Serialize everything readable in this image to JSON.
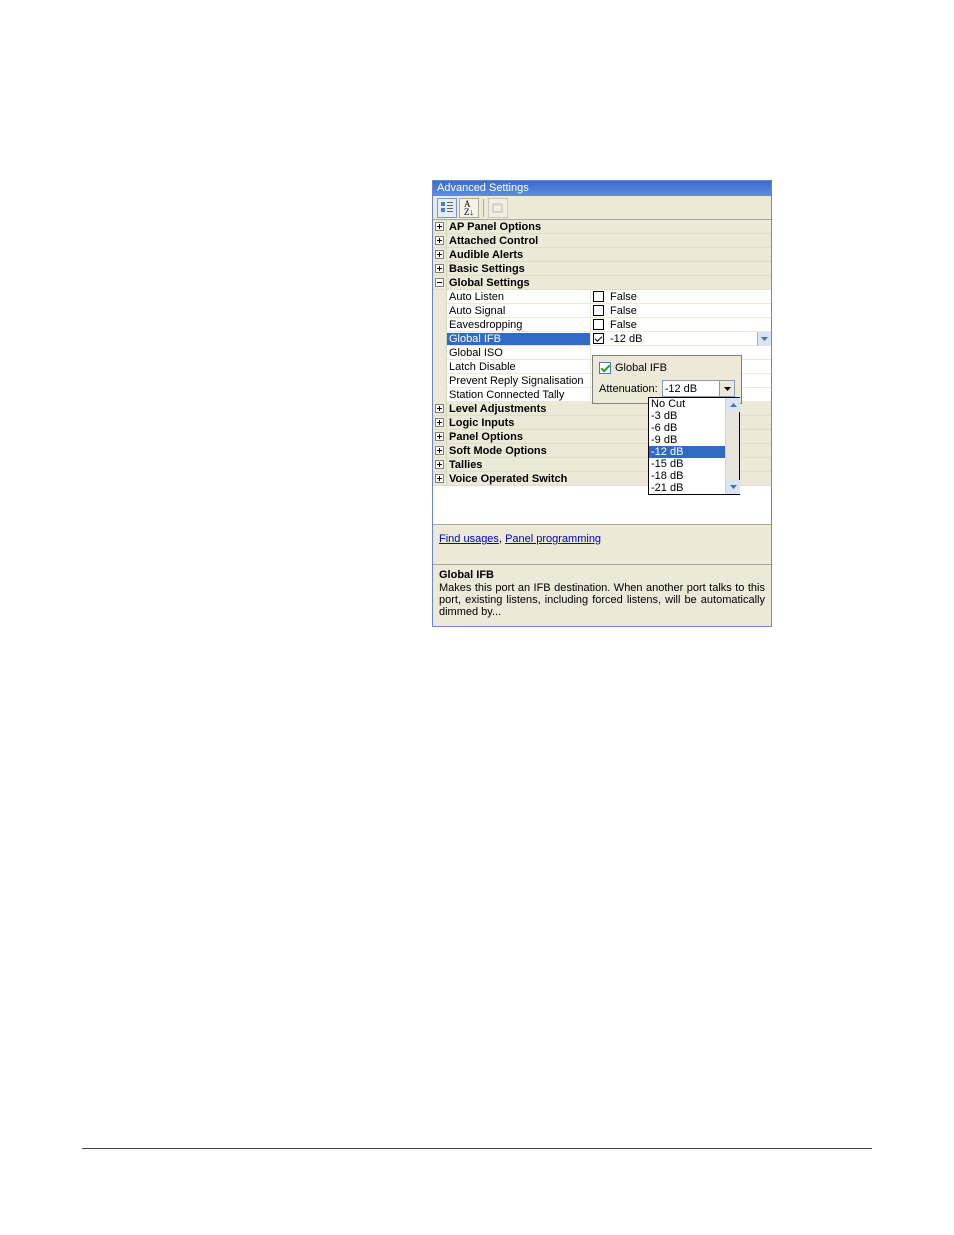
{
  "window": {
    "title": "Advanced Settings"
  },
  "categories": {
    "ap_panel": "AP Panel Options",
    "attached": "Attached Control",
    "audible": "Audible Alerts",
    "basic": "Basic Settings",
    "global": "Global Settings",
    "level": "Level Adjustments",
    "logic": "Logic Inputs",
    "panel": "Panel Options",
    "softmode": "Soft Mode Options",
    "tallies": "Tallies",
    "voice": "Voice Operated Switch"
  },
  "props": {
    "auto_listen": {
      "name": "Auto Listen",
      "value": "False"
    },
    "auto_signal": {
      "name": "Auto Signal",
      "value": "False"
    },
    "eavesdropping": {
      "name": "Eavesdropping",
      "value": "False"
    },
    "global_ifb": {
      "name": "Global IFB",
      "value": "-12 dB"
    },
    "global_iso": {
      "name": "Global ISO"
    },
    "latch_disable": {
      "name": "Latch Disable"
    },
    "prevent_reply": {
      "name": "Prevent Reply Signalisation"
    },
    "station_tally": {
      "name": "Station Connected Tally"
    }
  },
  "popup": {
    "checkbox_label": "Global IFB",
    "attenuation_label": "Attenuation:",
    "attenuation_value": "-12 dB"
  },
  "dropdown": {
    "options": [
      "No Cut",
      "-3 dB",
      "-6 dB",
      "-9 dB",
      "-12 dB",
      "-15 dB",
      "-18 dB",
      "-21 dB"
    ],
    "selected_index": 4
  },
  "links": {
    "find_usages": "Find usages",
    "separator": ", ",
    "panel_programming": "Panel programming"
  },
  "description": {
    "title": "Global IFB",
    "text": "Makes this port an IFB destination. When another port talks to this port, existing listens, including forced listens, will be automatically dimmed by..."
  }
}
